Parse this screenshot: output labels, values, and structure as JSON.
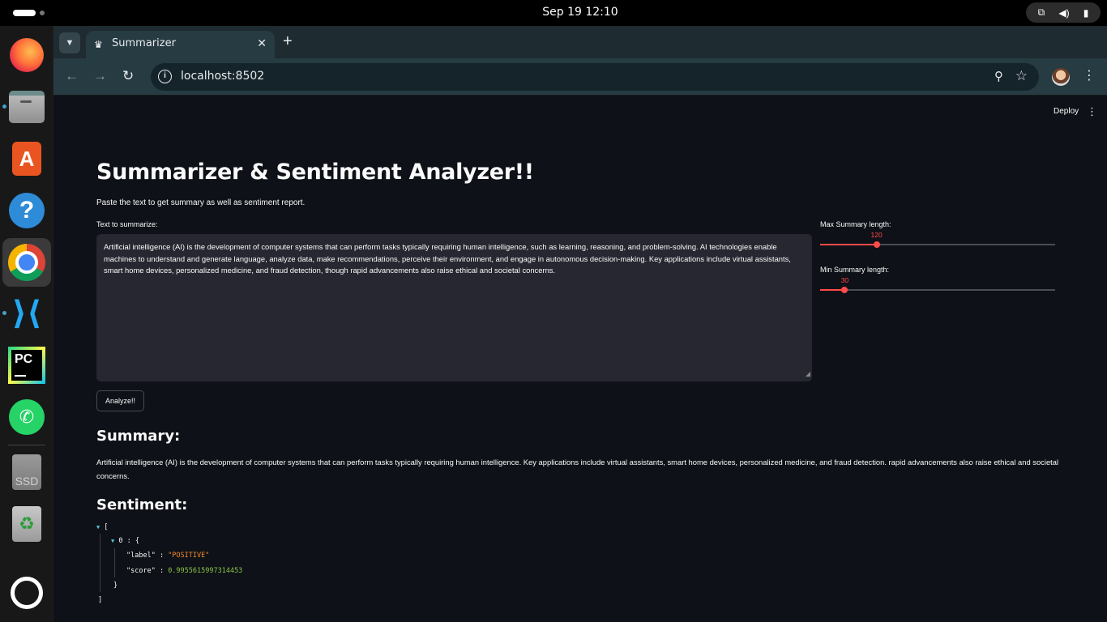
{
  "system": {
    "clock": "Sep 19  12:10",
    "tray_icons": [
      "network-icon",
      "volume-icon",
      "battery-icon"
    ]
  },
  "dock": {
    "items": [
      {
        "name": "firefox",
        "icon": "firefox-icon"
      },
      {
        "name": "files",
        "icon": "files-icon"
      },
      {
        "name": "app-center",
        "icon": "app-center-icon"
      },
      {
        "name": "help",
        "icon": "help-icon"
      },
      {
        "name": "chrome",
        "icon": "chrome-icon",
        "active": true
      },
      {
        "name": "vscode",
        "icon": "vscode-icon"
      },
      {
        "name": "pycharm",
        "icon": "pycharm-icon"
      },
      {
        "name": "whatsapp",
        "icon": "whatsapp-icon"
      },
      {
        "name": "ssd",
        "icon": "ssd-icon"
      },
      {
        "name": "trash",
        "icon": "trash-icon"
      },
      {
        "name": "show-apps",
        "icon": "ubuntu-icon"
      }
    ],
    "store_glyph": "A",
    "help_glyph": "?",
    "pycharm_glyph": "PC",
    "ssd_label": "SSD",
    "trash_glyph": "♻"
  },
  "browser": {
    "tab_title": "Summarizer",
    "tab_close": "✕",
    "new_tab": "+",
    "url": "localhost:8502"
  },
  "app": {
    "deploy_label": "Deploy",
    "menu_glyph": "⋮",
    "title": "Summarizer & Sentiment Analyzer!!",
    "subtitle": "Paste the text to get summary as well as sentiment report.",
    "text_label": "Text to summarize:",
    "text_value": "Artificial intelligence (AI) is the development of computer systems that can perform tasks typically requiring human intelligence, such as learning, reasoning, and problem-solving. AI technologies enable machines to understand and generate language, analyze data, make recommendations, perceive their environment, and engage in autonomous decision-making. Key applications include virtual assistants, smart home devices, personalized medicine, and fraud detection, though rapid advancements also raise ethical and societal concerns.",
    "analyze_label": "Analyze!!",
    "max_slider": {
      "label": "Max Summary length:",
      "value": "120",
      "fraction": 0.24
    },
    "min_slider": {
      "label": "Min Summary length:",
      "value": "30",
      "fraction": 0.105
    },
    "summary_heading": "Summary:",
    "summary_text": "Artificial intelligence (AI) is the development of computer systems that can perform tasks typically requiring human intelligence. Key applications include virtual assistants, smart home devices, personalized medicine, and fraud detection. rapid advancements also raise ethical and societal concerns.",
    "sentiment_heading": "Sentiment:",
    "sentiment_json": {
      "open_bracket": "[",
      "index": "0",
      "colon": " : ",
      "open_brace": "{",
      "label_key": "\"label\"",
      "label_value": "\"POSITIVE\"",
      "score_key": "\"score\"",
      "score_value": "0.9955615997314453",
      "close_brace": "}",
      "close_bracket": "]"
    },
    "accent_color": "#ff4b4b"
  }
}
